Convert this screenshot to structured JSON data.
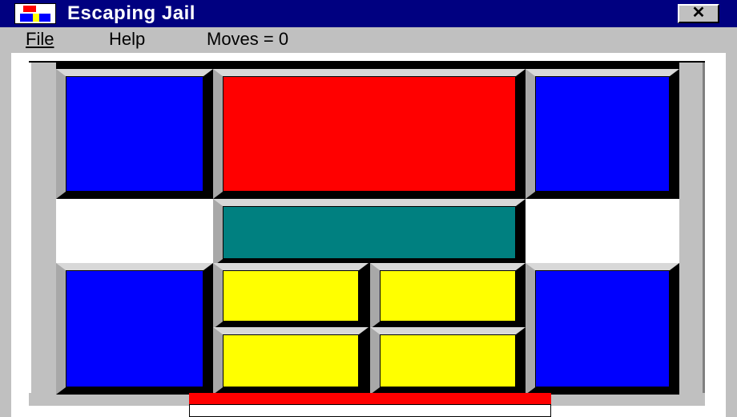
{
  "window": {
    "title": "Escaping Jail",
    "close_label": "✕",
    "icon_name": "app-icon"
  },
  "menu": {
    "items": [
      "File",
      "Help"
    ],
    "moves_text": "Moves = 0"
  },
  "game": {
    "grid_columns": 4,
    "grid_rows": 5,
    "blocks": [
      {
        "name": "blue-tall-block-top-left",
        "color": "#0000ff",
        "cells": "col 1, rows 1-2"
      },
      {
        "name": "red-big-block",
        "color": "#ff0000",
        "cells": "cols 2-3, rows 1-2"
      },
      {
        "name": "blue-tall-block-top-right",
        "color": "#0000ff",
        "cells": "col 4, rows 1-2"
      },
      {
        "name": "teal-wide-block",
        "color": "#008080",
        "cells": "cols 2-3, row 3"
      },
      {
        "name": "blue-tall-block-bottom-left",
        "color": "#0000ff",
        "cells": "col 1, rows 4-5"
      },
      {
        "name": "yellow-small-block-1",
        "color": "#ffff00",
        "cells": "col 2, row 4"
      },
      {
        "name": "yellow-small-block-2",
        "color": "#ffff00",
        "cells": "col 3, row 4"
      },
      {
        "name": "yellow-small-block-3",
        "color": "#ffff00",
        "cells": "col 2, row 5"
      },
      {
        "name": "yellow-small-block-4",
        "color": "#ffff00",
        "cells": "col 3, row 5"
      },
      {
        "name": "blue-tall-block-bottom-right",
        "color": "#0000ff",
        "cells": "col 4, rows 4-5"
      }
    ],
    "empty_cells": [
      "col 1, row 3",
      "col 4, row 3"
    ],
    "exit_color": "#ff0000"
  }
}
